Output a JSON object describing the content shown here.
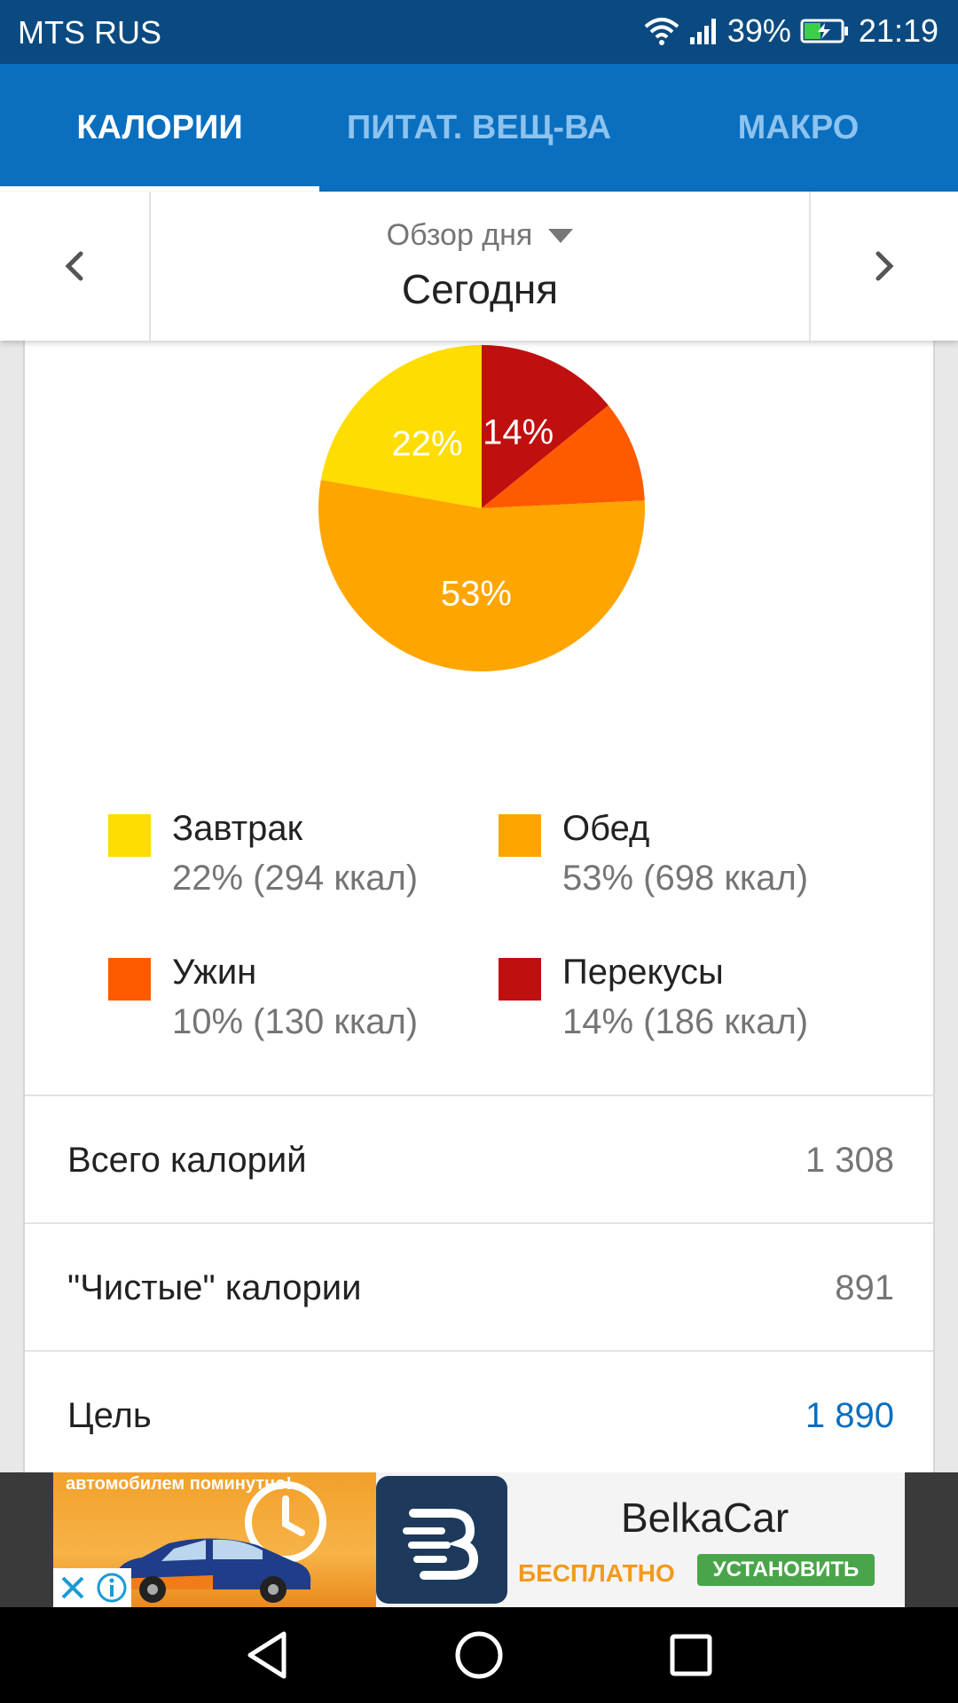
{
  "status_bar": {
    "carrier": "MTS RUS",
    "battery": "39%",
    "time": "21:19"
  },
  "tabs": [
    {
      "label": "КАЛОРИИ",
      "active": true
    },
    {
      "label": "ПИТАТ. ВЕЩ-ВА",
      "active": false
    },
    {
      "label": "МАКРО",
      "active": false
    }
  ],
  "date_selector": {
    "period_label": "Обзор дня",
    "day": "Сегодня"
  },
  "chart_data": {
    "type": "pie",
    "slices": [
      {
        "name": "Завтрак",
        "percent": 22,
        "kcal": 294,
        "color": "#FFDD00",
        "label": "22%"
      },
      {
        "name": "Обед",
        "percent": 53,
        "kcal": 698,
        "color": "#FFA500",
        "label": "53%"
      },
      {
        "name": "Ужин",
        "percent": 10,
        "kcal": 130,
        "color": "#FF5A00",
        "label": ""
      },
      {
        "name": "Перекусы",
        "percent": 14,
        "kcal": 186,
        "color": "#C00F0F",
        "label": "14%"
      }
    ]
  },
  "legend": [
    {
      "name": "Завтрак",
      "value": "22% (294 ккал)",
      "color": "#FFDD00"
    },
    {
      "name": "Обед",
      "value": "53% (698 ккал)",
      "color": "#FFA500"
    },
    {
      "name": "Ужин",
      "value": "10% (130 ккал)",
      "color": "#FF5A00"
    },
    {
      "name": "Перекусы",
      "value": "14% (186 ккал)",
      "color": "#C00F0F"
    }
  ],
  "summary": {
    "total_label": "Всего калорий",
    "total_value": "1 308",
    "net_label": "\"Чистые\" калории",
    "net_value": "891",
    "goal_label": "Цель",
    "goal_value": "1 890"
  },
  "ad": {
    "image_text": "автомобилем поминутно!",
    "brand": "BelkaCar",
    "free": "БЕСПЛАТНО",
    "install": "УСТАНОВИТЬ"
  },
  "colors": {
    "status_bar": "#0A4A80",
    "tab_bar": "#0A6FBF",
    "accent": "#0A6FBF"
  }
}
